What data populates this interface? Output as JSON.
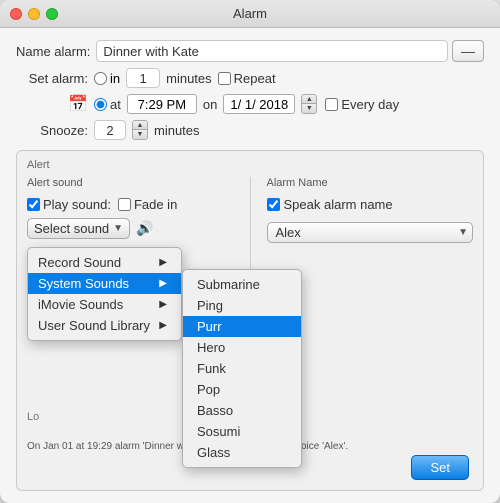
{
  "window": {
    "title": "Alarm"
  },
  "form": {
    "name_label": "Name alarm:",
    "name_value": "Dinner with Kate",
    "set_alarm_label": "Set alarm:",
    "in_label": "in",
    "minutes_label": "minutes",
    "repeat_label": "Repeat",
    "at_label": "at",
    "on_label": "on",
    "time_value": "7:29 PM",
    "date_value": "1/ 1/ 2018",
    "every_day_label": "Every day",
    "snooze_label": "Snooze:",
    "snooze_value": "2",
    "snooze_minutes": "minutes",
    "in_minutes_value": "1"
  },
  "alert": {
    "section_title": "Alert",
    "left_label": "Alert sound",
    "play_sound_label": "Play sound:",
    "fade_in_label": "Fade in",
    "select_sound_label": "Select sound",
    "record_sound_label": "Record Sound",
    "system_sounds_label": "System Sounds",
    "imovie_sounds_label": "iMovie Sounds",
    "user_sound_label": "User Sound Library",
    "lo_label": "Lo",
    "right_label": "Alarm Name",
    "speak_label": "Speak alarm name",
    "voice_value": "Alex"
  },
  "submenu": {
    "items": [
      {
        "label": "Submarine",
        "selected": false
      },
      {
        "label": "Ping",
        "selected": false
      },
      {
        "label": "Purr",
        "selected": true
      },
      {
        "label": "Hero",
        "selected": false
      },
      {
        "label": "Funk",
        "selected": false
      },
      {
        "label": "Pop",
        "selected": false
      },
      {
        "label": "Basso",
        "selected": false
      },
      {
        "label": "Sosumi",
        "selected": false
      },
      {
        "label": "Glass",
        "selected": false
      }
    ]
  },
  "buttons": {
    "set_label": "Set",
    "dash_label": "—"
  },
  "footer": {
    "text": "On Jan 01 at 19:29 alarm 'Dinner with Kate' will be spoke by voice 'Alex'."
  }
}
